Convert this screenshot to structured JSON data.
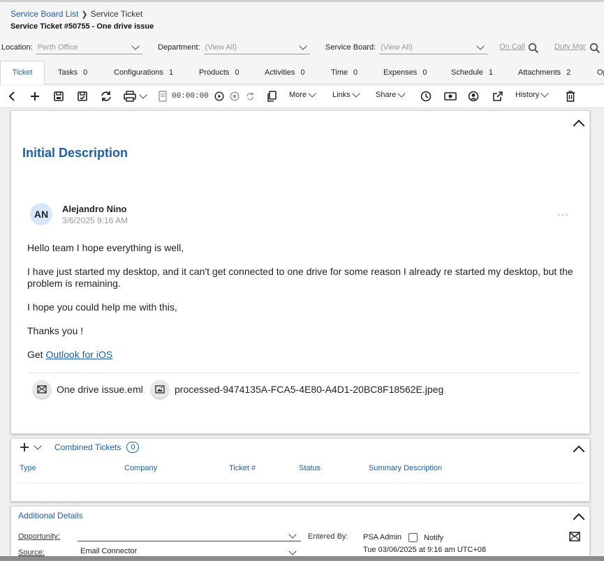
{
  "breadcrumb": {
    "parent": "Service Board List",
    "current": "Service Ticket"
  },
  "page_title": "Service Ticket #50755 - One drive issue",
  "filters": {
    "location": {
      "label": "Location:",
      "value": "Perth Office"
    },
    "department": {
      "label": "Department:",
      "value": "(View All)"
    },
    "service_board": {
      "label": "Service Board:",
      "value": "(View All)"
    },
    "on_call": "On Call",
    "duty_mgr": "Duty Mgr"
  },
  "tabs": [
    {
      "label": "Ticket",
      "count": ""
    },
    {
      "label": "Tasks",
      "count": "0"
    },
    {
      "label": "Configurations",
      "count": "1"
    },
    {
      "label": "Products",
      "count": "0"
    },
    {
      "label": "Activities",
      "count": "0"
    },
    {
      "label": "Time",
      "count": "0"
    },
    {
      "label": "Expenses",
      "count": "0"
    },
    {
      "label": "Schedule",
      "count": "1"
    },
    {
      "label": "Attachments",
      "count": "2"
    },
    {
      "label": "Op",
      "count": ""
    }
  ],
  "toolbar": {
    "timer": "00:00:00",
    "more": "More",
    "links": "Links",
    "share": "Share",
    "history": "History"
  },
  "description": {
    "title": "Initial Description",
    "avatar_initials": "AN",
    "author": "Alejandro Nino",
    "posted": "3/6/2025 9:16 AM",
    "more": "···",
    "paragraphs": [
      "Hello team I hope everything is well,",
      "I have just started my desktop, and it can't get connected to one drive for some reason I already re started my desktop, but the problem is remaining.",
      "I hope you could help me with this,",
      "Thanks you !"
    ],
    "get_prefix": "Get ",
    "get_link": "Outlook for iOS",
    "attachments": [
      {
        "name": "One drive issue.eml",
        "icon": "email-icon"
      },
      {
        "name": "processed-9474135A-FCA5-4E80-A4D1-20BC8F18562E.jpeg",
        "icon": "image-icon"
      }
    ]
  },
  "combined_tickets": {
    "title": "Combined Tickets",
    "count": "0",
    "columns": [
      "Type",
      "Company",
      "Ticket #",
      "Status",
      "Summary Description"
    ]
  },
  "additional_details": {
    "title": "Additional Details",
    "opportunity_label": "Opportunity:",
    "opportunity_value": "",
    "source_label": "Source:",
    "source_value": "Email Connector",
    "entered_by_label": "Entered By:",
    "entered_by_value": "PSA Admin",
    "notify_label": "Notify",
    "entered_date": "Tue 03/06/2025 at 9:16 am UTC+08"
  },
  "colors": {
    "accent": "#1a5fa8",
    "muted": "#999999"
  }
}
